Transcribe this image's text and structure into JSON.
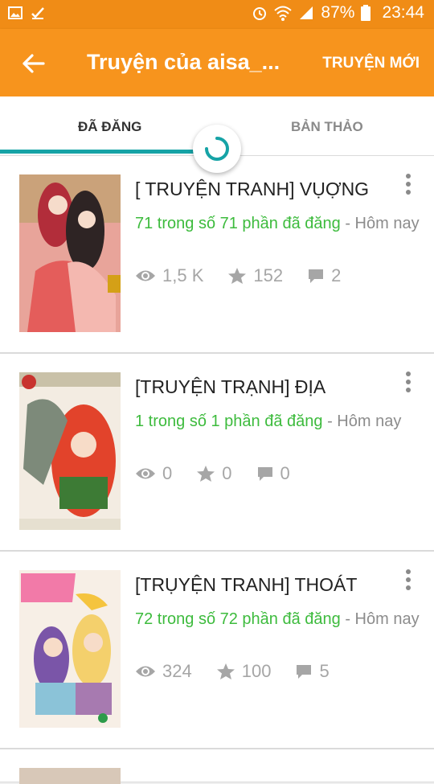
{
  "status_bar": {
    "battery": "87%",
    "time": "23:44"
  },
  "app_bar": {
    "title": "Truyện của aisa_...",
    "new_story": "TRUYỆN MỚI"
  },
  "tabs": [
    {
      "label": "ĐÃ ĐĂNG"
    },
    {
      "label": "BẢN THẢO"
    }
  ],
  "stories": [
    {
      "title": "[ TRUYỆN TRANH] VỤỢNG",
      "parts": "71 trong số 71 phần đã đăng",
      "updated": "- Hôm nay",
      "views": "1,5 K",
      "votes": "152",
      "comments": "2"
    },
    {
      "title": "[TRUYỆN TRẠNH] ĐỊA",
      "parts": "1 trong số 1 phần đã đăng",
      "updated": "- Hôm nay",
      "views": "0",
      "votes": "0",
      "comments": "0"
    },
    {
      "title": "[TRỤYỆN TRANH] THOÁT",
      "parts": "72 trong số 72 phần đã đăng",
      "updated": "- Hôm nay",
      "views": "324",
      "votes": "100",
      "comments": "5"
    }
  ],
  "colors": {
    "accent": "#f7941d",
    "published_green": "#3dbb3d",
    "tab_indicator": "#16a3a6"
  }
}
